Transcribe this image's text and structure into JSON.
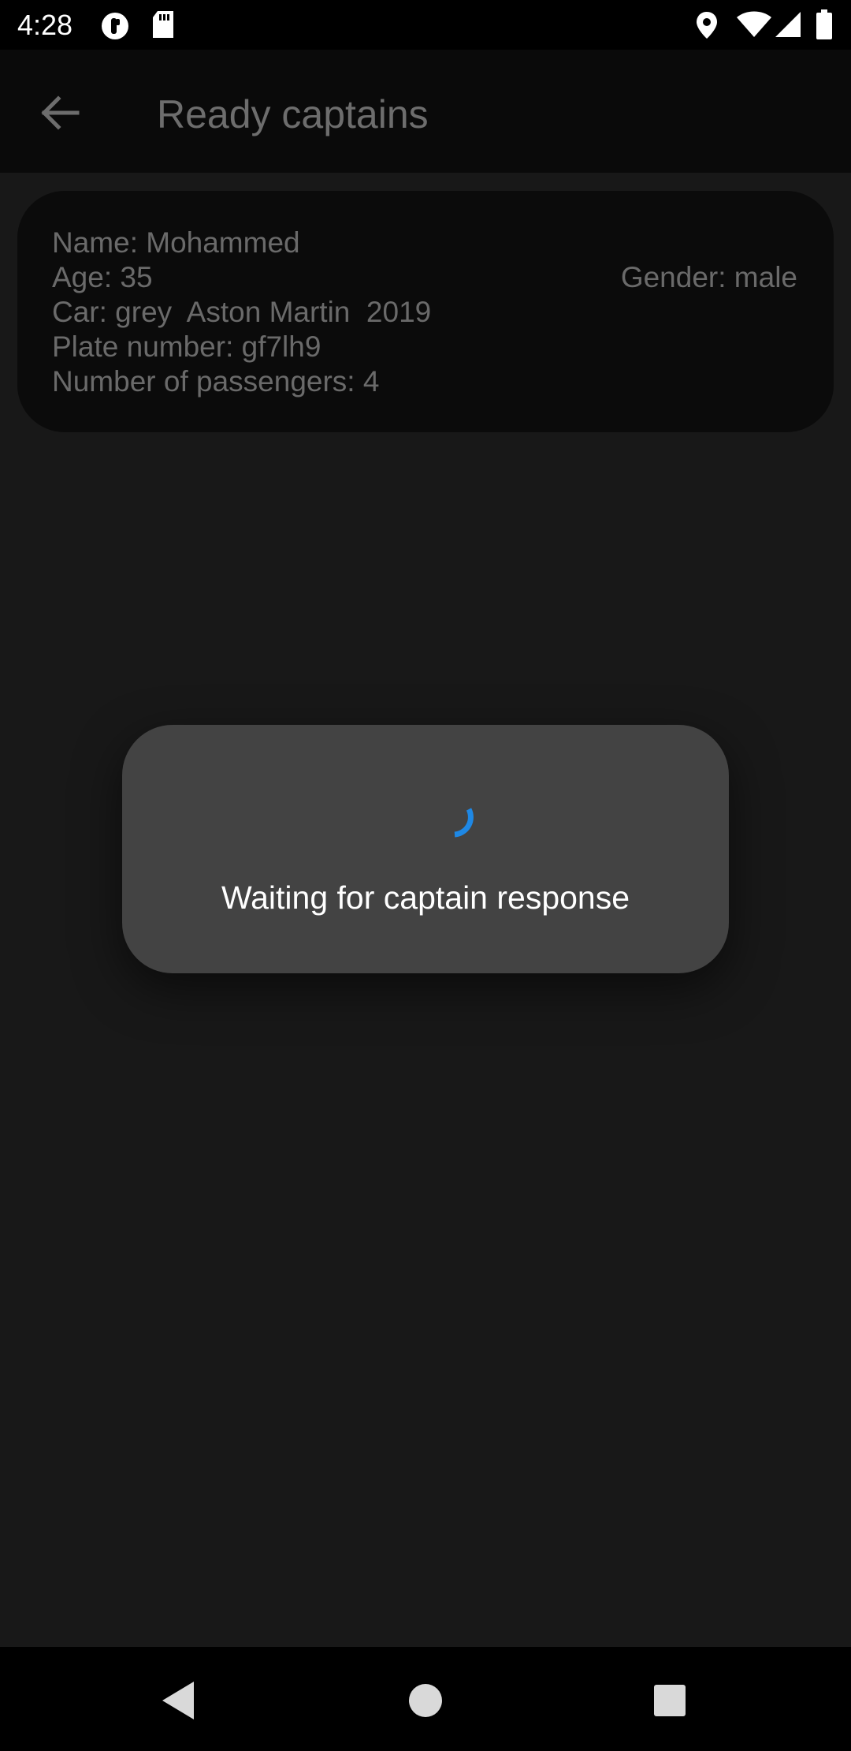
{
  "status_bar": {
    "time": "4:28",
    "left_icons": [
      "data-saver-icon",
      "sd-card-icon"
    ],
    "right_icons": [
      "location-icon",
      "wifi-icon",
      "signal-icon",
      "battery-icon"
    ]
  },
  "app_bar": {
    "back_icon": "arrow-back-icon",
    "title": "Ready captains"
  },
  "captain": {
    "name": "Name: Mohammed",
    "age": "Age: 35",
    "car": "Car: grey  Aston Martin  2019",
    "plate": "Plate number: gf7lh9",
    "passengers": "Number of passengers: 4",
    "gender": "Gender: male"
  },
  "dialog": {
    "message": "Waiting for captain response",
    "spinner_color": "#1e88e5"
  },
  "nav_bar": {
    "icons": [
      "back-triangle-icon",
      "home-circle-icon",
      "recents-square-icon"
    ]
  },
  "colors": {
    "background": "#181818",
    "card": "#0b0b0b",
    "dialog": "#434343",
    "accent": "#1e88e5"
  }
}
